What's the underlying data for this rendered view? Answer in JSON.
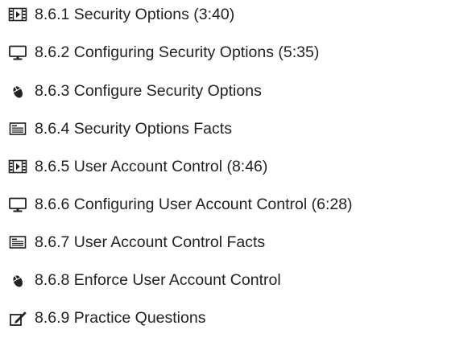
{
  "lessons": [
    {
      "icon": "video-icon",
      "label": "8.6.1 Security Options (3:40)"
    },
    {
      "icon": "monitor-icon",
      "label": "8.6.2 Configuring Security Options (5:35)"
    },
    {
      "icon": "mouse-icon",
      "label": "8.6.3 Configure Security Options"
    },
    {
      "icon": "document-icon",
      "label": "8.6.4 Security Options Facts"
    },
    {
      "icon": "video-icon",
      "label": "8.6.5 User Account Control (8:46)"
    },
    {
      "icon": "monitor-icon",
      "label": "8.6.6 Configuring User Account Control (6:28)"
    },
    {
      "icon": "document-icon",
      "label": "8.6.7 User Account Control Facts"
    },
    {
      "icon": "mouse-icon",
      "label": "8.6.8 Enforce User Account Control"
    },
    {
      "icon": "edit-icon",
      "label": "8.6.9 Practice Questions"
    }
  ]
}
